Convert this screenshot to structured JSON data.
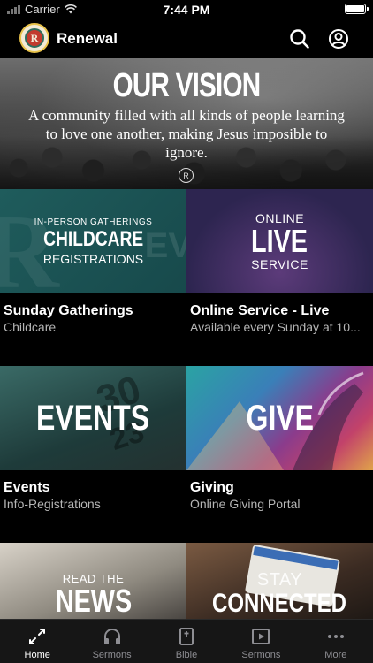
{
  "status_bar": {
    "carrier": "Carrier",
    "time": "7:44 PM"
  },
  "header": {
    "title": "Renewal",
    "logo_letter": "R"
  },
  "hero": {
    "title": "OUR VISION",
    "subtitle": "A community filled with all kinds of people learning to love one another, making Jesus imposible to ignore."
  },
  "tiles": [
    {
      "image_lines": {
        "top": "IN-PERSON GATHERINGS",
        "big": "CHILDCARE",
        "bottom": "REGISTRATIONS"
      },
      "title": "Sunday Gatherings",
      "subtitle": "Childcare"
    },
    {
      "image_lines": {
        "top": "ONLINE",
        "big": "LIVE",
        "bottom": "SERVICE"
      },
      "title": "Online Service - Live",
      "subtitle": "Available every Sunday at 10..."
    },
    {
      "image_lines": {
        "big": "EVENTS"
      },
      "title": "Events",
      "subtitle": "Info-Registrations"
    },
    {
      "image_lines": {
        "big": "GIVE"
      },
      "title": "Giving",
      "subtitle": "Online Giving Portal"
    },
    {
      "image_lines": {
        "top": "READ THE",
        "big": "NEWS"
      }
    },
    {
      "image_lines": {
        "top": "STAY",
        "big": "CONNECTED"
      }
    }
  ],
  "tab_bar": [
    {
      "label": "Home",
      "icon": "home-icon",
      "active": true
    },
    {
      "label": "Sermons",
      "icon": "headphones-icon",
      "active": false
    },
    {
      "label": "Bible",
      "icon": "bible-icon",
      "active": false
    },
    {
      "label": "Sermons",
      "icon": "video-icon",
      "active": false
    },
    {
      "label": "More",
      "icon": "more-icon",
      "active": false
    }
  ]
}
